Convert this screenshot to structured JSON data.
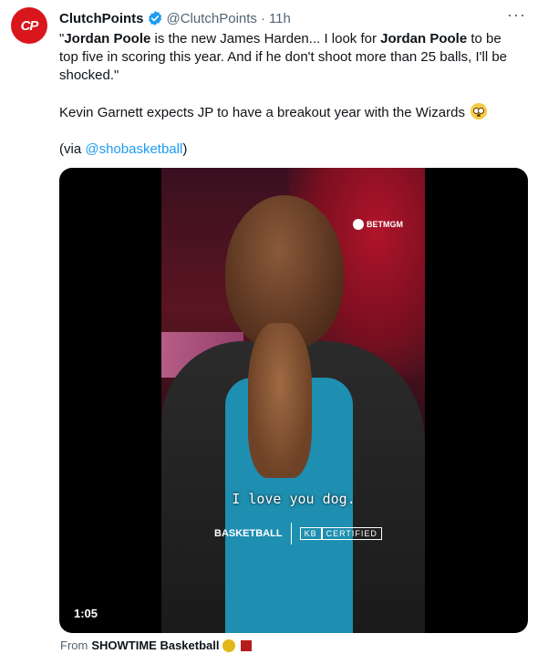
{
  "account": {
    "avatar_text": "CP",
    "display_name": "ClutchPoints",
    "handle": "@ClutchPoints",
    "separator": "·",
    "time": "11h",
    "more_icon": "···"
  },
  "tweet": {
    "p1_quote_open": "\"",
    "p1_bold1": "Jordan Poole",
    "p1_text1": " is the new James Harden... I look for ",
    "p1_bold2": "Jordan Poole",
    "p1_text2": " to be top five in scoring this year. And if he don't shoot more than 25 balls, I'll be shocked.\"",
    "p2": "Kevin Garnett expects JP to have a breakout year with the Wizards",
    "p3_prefix": "(via ",
    "p3_mention": "@shobasketball",
    "p3_suffix": ")"
  },
  "video": {
    "watermark": "BETMGM",
    "caption": "I love you dog.",
    "brand_left": "BASKETBALL",
    "brand_right_kb": "KB",
    "brand_right_certified": "CERTIFIED",
    "duration": "1:05"
  },
  "source": {
    "prefix": "From",
    "name": "SHOWTIME Basketball"
  },
  "colors": {
    "link": "#1d9bf0",
    "verified": "#1d9bf0",
    "avatar_bg": "#d9161c",
    "muted": "#536471"
  }
}
